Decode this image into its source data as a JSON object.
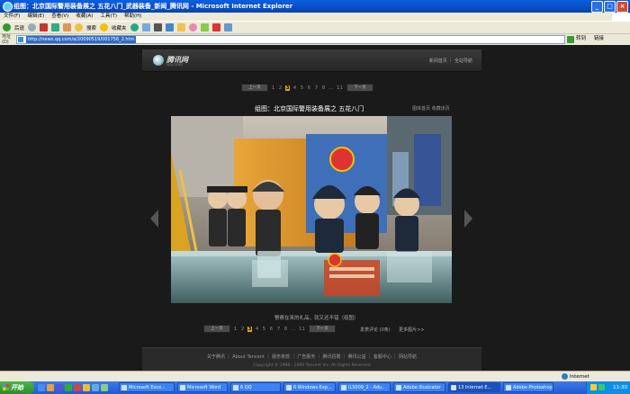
{
  "window": {
    "title": "组图：北京国际警用装备展之 五花八门_武器装备_新闻_腾讯网 - Microsoft Internet Explorer"
  },
  "menu": [
    "文件(F)",
    "编辑(E)",
    "查看(V)",
    "收藏(A)",
    "工具(T)",
    "帮助(H)"
  ],
  "toolbar": {
    "back_label": "后退",
    "search_label": "搜索",
    "favorites_label": "收藏夹"
  },
  "address": {
    "label": "地址(D)",
    "url": "http://news.qq.com/a/20090519/001756_2.htm",
    "go_label": "转到",
    "links_label": "链接"
  },
  "site": {
    "logo_text": "腾讯网",
    "logo_sub": "QQ.com",
    "top_links": "新闻首页 ｜ 全站导航"
  },
  "pager_top": {
    "prev_label": "上一页",
    "next_label": "下一页",
    "pages": [
      "1",
      "2",
      "3",
      "4",
      "5",
      "6",
      "7",
      "8",
      "…",
      "11"
    ],
    "current": "3"
  },
  "photo": {
    "title": "组图：北京国际警用装备展之 五花八门",
    "links": "图库首页  收藏该页",
    "caption": "警察在来的礼品，就又还不错（组图）"
  },
  "pager_bottom": {
    "pages": [
      "1",
      "2",
      "3",
      "4",
      "5",
      "6",
      "7",
      "8",
      "…",
      "11"
    ],
    "current": "3",
    "comment_link": "发表评论 (0条)",
    "more_link": "更多图片>>"
  },
  "footer": {
    "links": "关于腾讯 ｜ About Tencent ｜ 服务条款 ｜ 广告服务 ｜ 腾讯招聘 ｜ 腾讯公益 ｜ 客服中心 ｜ 网站导航",
    "copyright": "Copyright © 1998 - 2009 Tencent Inc. All Rights Reserved"
  },
  "status": {
    "zone": "Internet"
  },
  "taskbar": {
    "start_label": "开始",
    "tasks": [
      "Microsoft Exce...",
      "Microsoft Word",
      "6 QQ",
      "6 Windows Exp...",
      "ILS009_2 - Adu...",
      "Adobe Illustrator",
      "13 Internet E...",
      "Adobe Photoshop"
    ],
    "clock": "11:30"
  },
  "colors": {
    "title_bar": "#0a5fe0",
    "page_bg": "#1a1a1a",
    "current_page": "#d9a520"
  }
}
